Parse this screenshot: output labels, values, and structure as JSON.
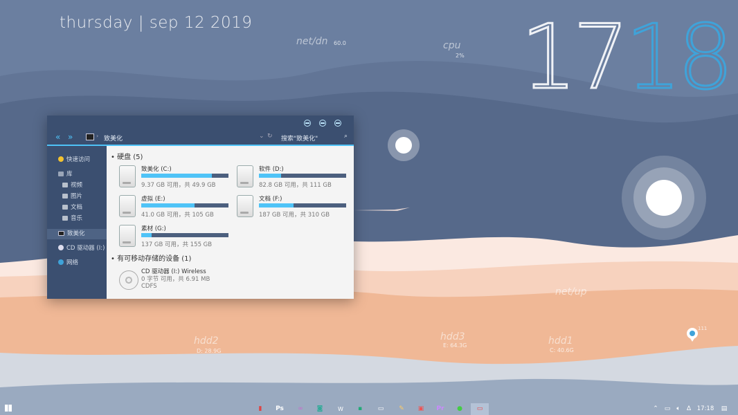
{
  "desktop": {
    "date": "thursday | sep 12 2019",
    "clock_hour": "17",
    "clock_minute": "18",
    "net_down_label": "net/dn",
    "net_down_value": "60.0",
    "cpu_label": "cpu",
    "cpu_value": "2%",
    "net_up_label": "net/up",
    "hdd_widgets": [
      {
        "label": "hdd2",
        "value": "D: 28.9G"
      },
      {
        "label": "hdd3",
        "value": "E: 64.3G"
      },
      {
        "label": "hdd1",
        "value": "C: 40.6G"
      }
    ],
    "bubble_value": "111",
    "colors": {
      "accent": "#4fc3f7",
      "clock_minute": "#3fa3d9",
      "window_dark": "#3b4f70",
      "sand": "#f0b896",
      "sky": "#6b7fa0"
    }
  },
  "explorer": {
    "breadcrumb": "致美化",
    "search_placeholder": "搜索\"致美化\"",
    "nav_icons": [
      "back-icon",
      "forward-icon",
      "computer-icon",
      "refresh-icon",
      "search-icon"
    ],
    "sidebar": [
      {
        "label": "快速访问",
        "icon": "star-icon"
      },
      {
        "label": "库",
        "icon": "library-icon"
      },
      {
        "label": "视频",
        "icon": "folder-icon"
      },
      {
        "label": "图片",
        "icon": "folder-icon"
      },
      {
        "label": "文档",
        "icon": "folder-icon"
      },
      {
        "label": "音乐",
        "icon": "folder-icon"
      },
      {
        "label": "致美化",
        "icon": "computer-icon"
      },
      {
        "label": "CD 驱动器 (I:)",
        "icon": "cd-icon"
      },
      {
        "label": "网络",
        "icon": "network-icon"
      }
    ],
    "hard_disks_title": "硬盘 (5)",
    "drives": [
      {
        "name": "致美化 (C:)",
        "info": "9.37 GB 可用，共 49.9 GB",
        "used_fraction": 0.81
      },
      {
        "name": "软件 (D:)",
        "info": "82.8 GB 可用，共 111 GB",
        "used_fraction": 0.25
      },
      {
        "name": "虚拟 (E:)",
        "info": "41.0 GB 可用，共 105 GB",
        "used_fraction": 0.61
      },
      {
        "name": "文档 (F:)",
        "info": "187 GB 可用，共 310 GB",
        "used_fraction": 0.4
      },
      {
        "name": "素材 (G:)",
        "info": "137 GB 可用，共 155 GB",
        "used_fraction": 0.12
      }
    ],
    "removable_title": "有可移动存储的设备 (1)",
    "cd": {
      "name": "CD 驱动器 (I:) Wireless",
      "info": "0 字节 可用，共 6.91 MB",
      "fs": "CDFS"
    }
  },
  "taskbar": {
    "apps": [
      "pdf-icon",
      "Ps",
      "chain-icon",
      "camera-icon",
      "W",
      "excel-icon",
      "book-icon",
      "pencil-icon",
      "media-icon",
      "Pr",
      "browser-icon",
      "computer-icon"
    ],
    "time": "17:18"
  }
}
